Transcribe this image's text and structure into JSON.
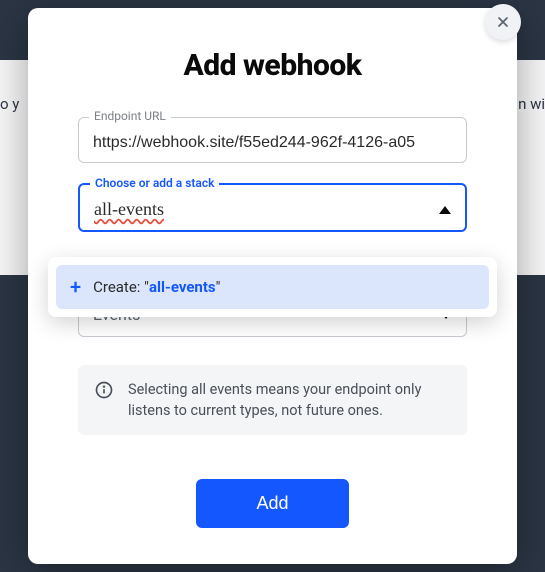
{
  "bg": {
    "left": "o y",
    "right": "n wi"
  },
  "modal": {
    "title": "Add webhook",
    "endpoint": {
      "label": "Endpoint URL",
      "value": "https://webhook.site/f55ed244-962f-4126-a05"
    },
    "stack": {
      "label": "Choose or add a stack",
      "value": "all-events",
      "create_prefix": "Create: \"",
      "create_value": "all-events",
      "create_suffix": "\""
    },
    "events": {
      "label": "Events"
    },
    "info": "Selecting all events means your endpoint only listens to current types, not future ones.",
    "add_label": "Add"
  }
}
